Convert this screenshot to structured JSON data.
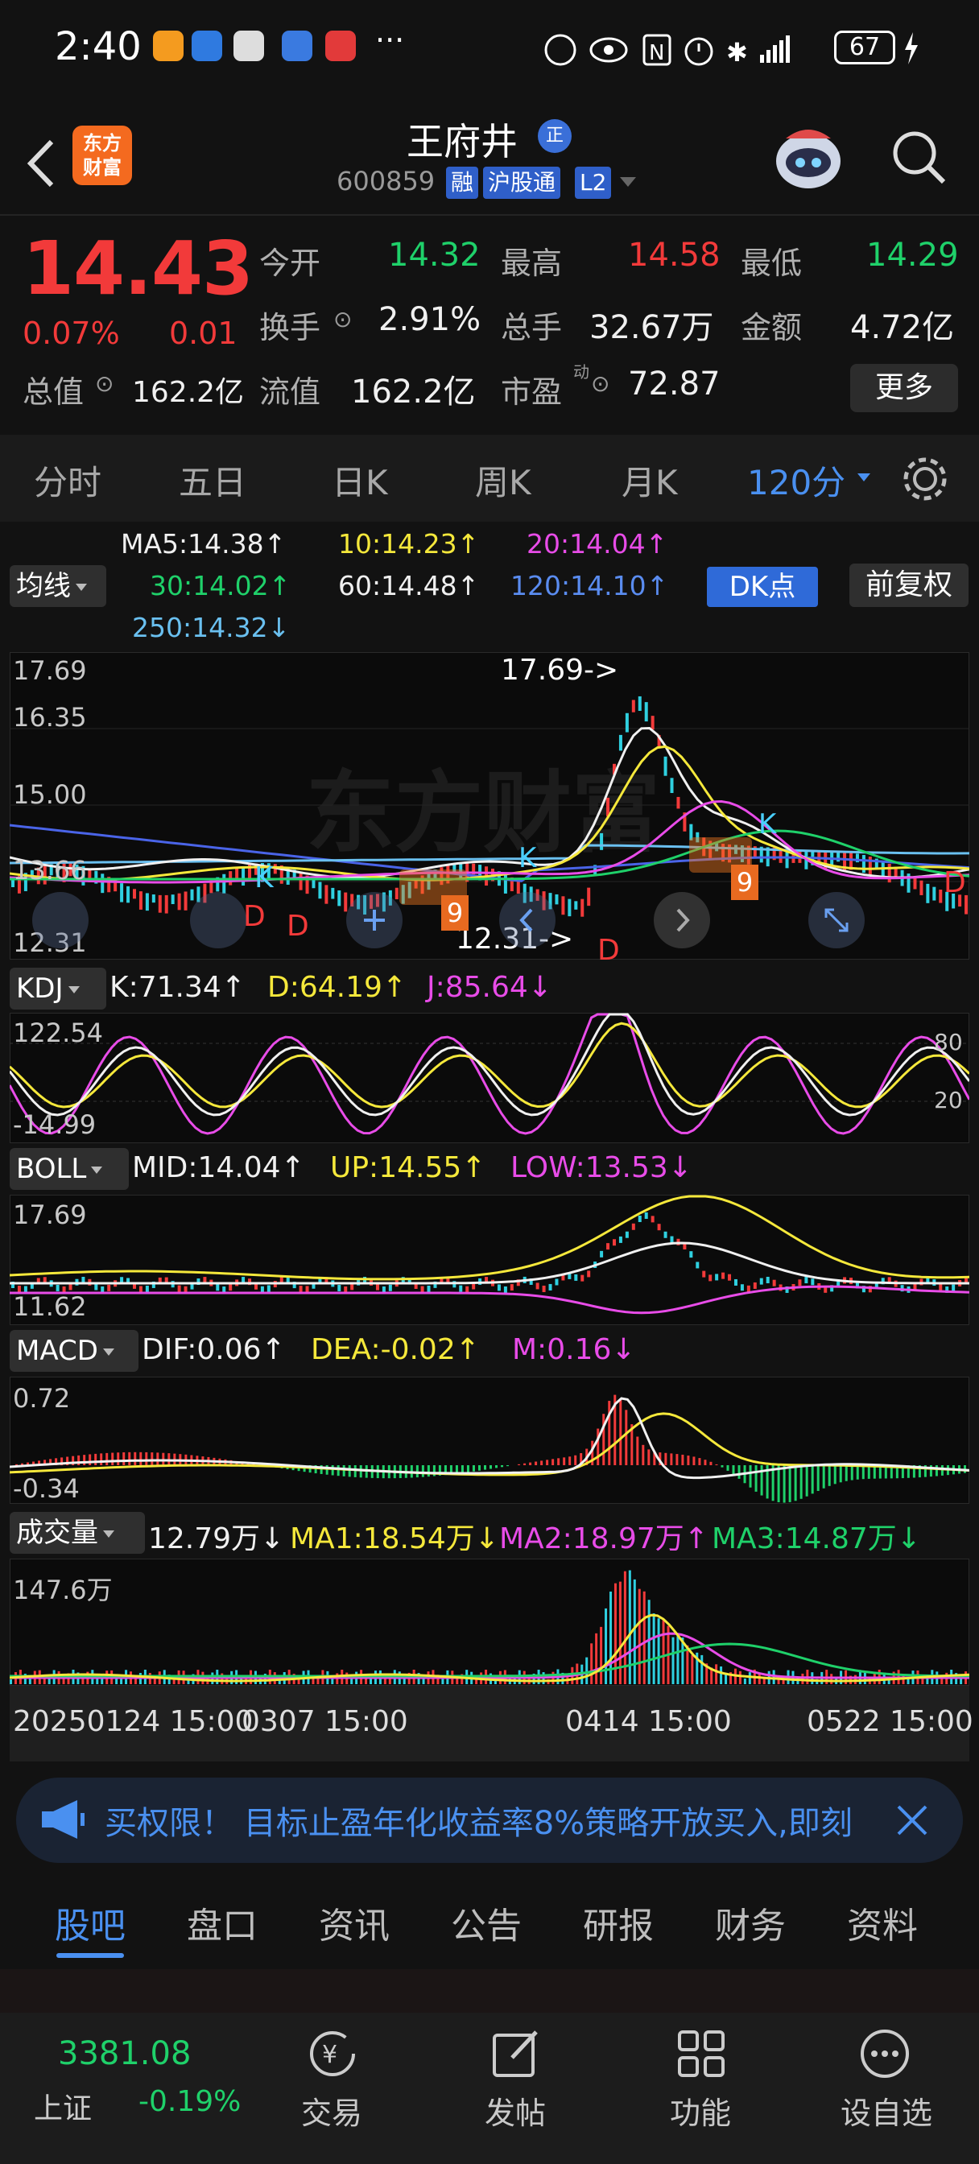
{
  "status": {
    "time": "2:40",
    "dots": "···",
    "battery": "67"
  },
  "header": {
    "logo_line1": "东方",
    "logo_line2": "财富",
    "stock_name": "王府井",
    "badge": "正",
    "code": "600859",
    "tags": [
      "融",
      "沪股通",
      "L2"
    ]
  },
  "quote": {
    "price": "14.43",
    "change_pct": "0.07%",
    "change": "0.01",
    "open_label": "今开",
    "open": "14.32",
    "high_label": "最高",
    "high": "14.58",
    "low_label": "最低",
    "low": "14.29",
    "turnover_label": "换手",
    "turnover": "2.91%",
    "volume_label": "总手",
    "volume": "32.67万",
    "amount_label": "金额",
    "amount": "4.72亿",
    "mktcap_label": "总值",
    "mktcap": "162.2亿",
    "float_label": "流值",
    "float": "162.2亿",
    "pe_label": "市盈",
    "pe_sup": "动",
    "pe": "72.87",
    "more": "更多"
  },
  "period_tabs": [
    "分时",
    "五日",
    "日K",
    "周K",
    "月K",
    "120分"
  ],
  "ma": {
    "selector": "均线",
    "ma5": "MA5:14.38↑",
    "ma10": "10:14.23↑",
    "ma20": "20:14.04↑",
    "ma30": "30:14.02↑",
    "ma60": "60:14.48↑",
    "ma120": "120:14.10↑",
    "ma250": "250:14.32↓",
    "dk": "DK点",
    "fuquan": "前复权"
  },
  "main_chart": {
    "y_top": "17.69",
    "y_2": "16.35",
    "y_3": "15.00",
    "y_4": "13.66",
    "y_bottom": "12.31",
    "high_ann": "17.69->",
    "low_ann": "12.31->",
    "watermark": "东方财富",
    "signals_k": [
      "K",
      "K",
      "K"
    ],
    "signals_d": [
      "D",
      "D",
      "D",
      "D"
    ],
    "nine": [
      "9",
      "9"
    ]
  },
  "kdj": {
    "selector": "KDJ",
    "k": "K:71.34↑",
    "d": "D:64.19↑",
    "j": "J:85.64↓",
    "y_top": "122.54",
    "y_bottom": "-14.99",
    "r80": "80",
    "r20": "20"
  },
  "boll": {
    "selector": "BOLL",
    "mid": "MID:14.04↑",
    "up": "UP:14.55↑",
    "low": "LOW:13.53↓",
    "y_top": "17.69",
    "y_bottom": "11.62"
  },
  "macd": {
    "selector": "MACD",
    "dif": "DIF:0.06↑",
    "dea": "DEA:-0.02↑",
    "m": "M:0.16↓",
    "y_top": "0.72",
    "y_bottom": "-0.34"
  },
  "vol": {
    "selector": "成交量",
    "v": "12.79万↓",
    "ma1": "MA1:18.54万↓",
    "ma2": "MA2:18.97万↑",
    "ma3": "MA3:14.87万↓",
    "y_top": "147.6万",
    "dates": [
      "20250124 15:00",
      "0307 15:00",
      "0414 15:00",
      "0522 15:00"
    ]
  },
  "banner": {
    "text": "买权限！ 目标止盈年化收益率8%策略开放买入,即刻"
  },
  "sub_tabs": [
    "股吧",
    "盘口",
    "资讯",
    "公告",
    "研报",
    "财务",
    "资料"
  ],
  "bottom": {
    "index_value": "3381.08",
    "index_name": "上证",
    "index_change": "-0.19%",
    "nav": [
      "交易",
      "发帖",
      "功能",
      "设自选"
    ]
  },
  "colors": {
    "up": "#f23a3a",
    "down": "#1fd16a",
    "accent": "#4a90f0",
    "background": "#121212"
  }
}
